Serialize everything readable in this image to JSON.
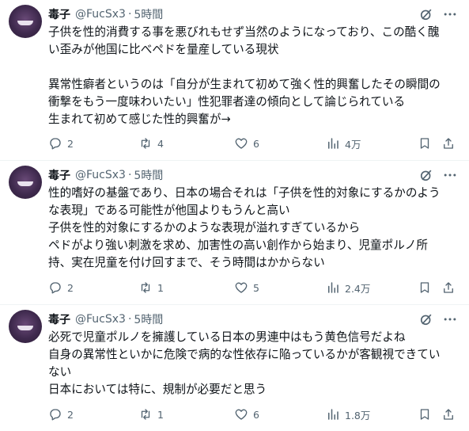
{
  "tweets": [
    {
      "author_name": "毒子",
      "handle": "@FucSx3",
      "separator": "·",
      "time": "5時間",
      "lines": [
        "子供を性的消費する事を悪びれもせず当然のようになっており、この酷く醜",
        "い歪みが他国に比べペドを量産している現状",
        "",
        "異常性癖者というのは「自分が生まれて初めて強く性的興奮したその瞬間の",
        "衝撃をもう一度味わいたい」性犯罪者達の傾向として論じられている",
        "生まれて初めて感じた性的興奮が→"
      ],
      "replies": "2",
      "retweets": "4",
      "likes": "6",
      "views": "4万"
    },
    {
      "author_name": "毒子",
      "handle": "@FucSx3",
      "separator": "·",
      "time": "5時間",
      "lines": [
        "性的嗜好の基盤であり、日本の場合それは「子供を性的対象にするかのよう",
        "な表現」である可能性が他国よりもうんと高い",
        "子供を性的対象にするかのような表現が溢れすぎているから",
        "ペドがより強い刺激を求め、加害性の高い創作から始まり、児童ポルノ所",
        "持、実在児童を付け回すまで、そう時間はかからない"
      ],
      "replies": "2",
      "retweets": "1",
      "likes": "5",
      "views": "2.4万"
    },
    {
      "author_name": "毒子",
      "handle": "@FucSx3",
      "separator": "·",
      "time": "5時間",
      "lines": [
        "必死で児童ポルノを擁護している日本の男連中はもう黄色信号だよね",
        "自身の異常性といかに危険で病的な性依存に陥っているかが客観視できてい",
        "ない",
        "日本においては特に、規制が必要だと思う"
      ],
      "replies": "2",
      "retweets": "1",
      "likes": "6",
      "views": "1.8万"
    }
  ],
  "colors": {
    "text": "#0f1419",
    "secondary": "#536471",
    "divider": "#eff3f4",
    "avatar": "#3f2a4e"
  },
  "icons": [
    "grok-icon",
    "more-icon",
    "reply-icon",
    "retweet-icon",
    "like-icon",
    "views-icon",
    "bookmark-icon",
    "share-icon"
  ]
}
